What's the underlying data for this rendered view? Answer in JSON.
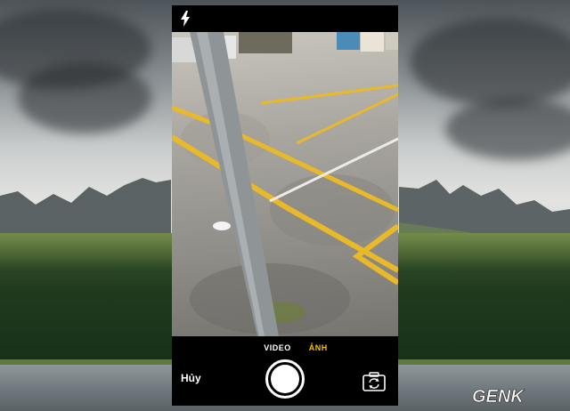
{
  "camera": {
    "modes": [
      "VIDEO",
      "ẢNH"
    ],
    "selected_mode": "ẢNH",
    "cancel_label": "Hủy",
    "accent_color": "#f2c200"
  },
  "icons": {
    "flash": "flash-icon",
    "shutter": "shutter-icon",
    "switch_camera": "camera-switch-icon"
  },
  "watermark": {
    "text": "GENK"
  }
}
